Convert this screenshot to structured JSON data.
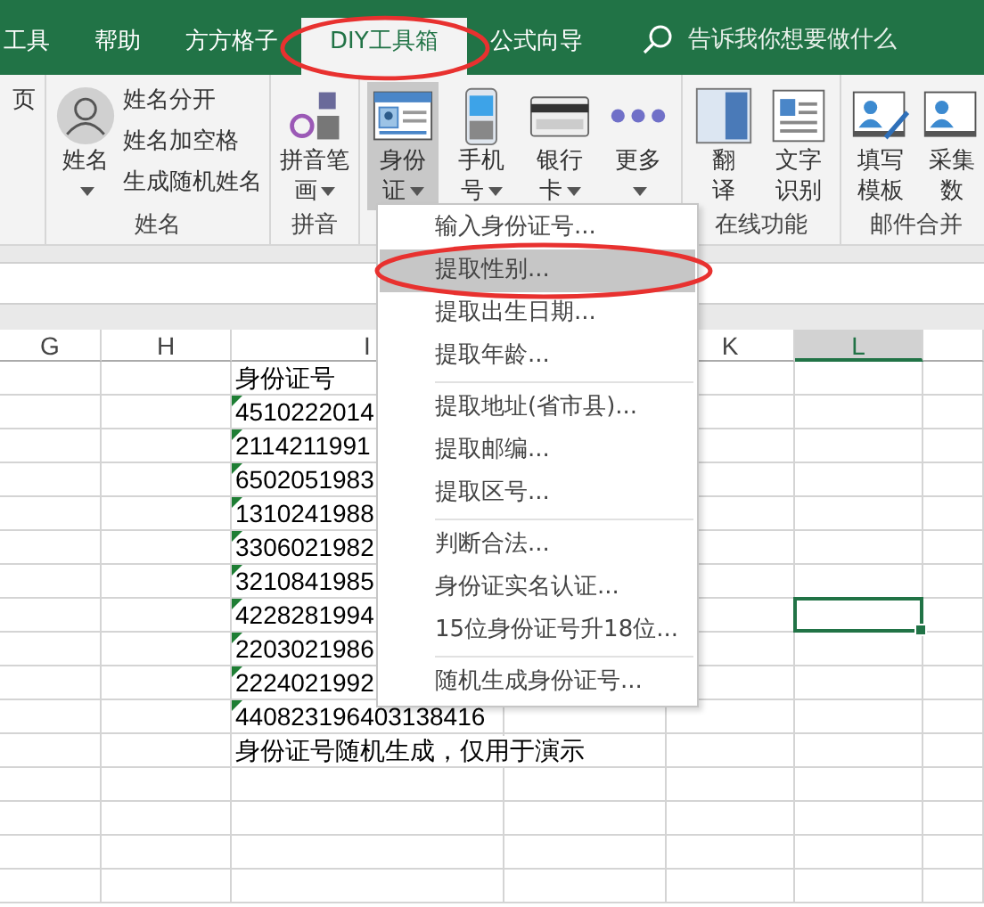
{
  "tabs": [
    {
      "label": "工具",
      "selected": false,
      "circled": false
    },
    {
      "label": "帮助",
      "selected": false,
      "circled": false
    },
    {
      "label": "方方格子",
      "selected": false,
      "circled": false
    },
    {
      "label": "DIY工具箱",
      "selected": true,
      "circled": true
    },
    {
      "label": "公式向导",
      "selected": false,
      "circled": false
    }
  ],
  "search": {
    "placeholder": "告诉我你想要做什么"
  },
  "ribbon": {
    "groups": [
      {
        "small": [
          "页"
        ]
      },
      {
        "label": "姓名",
        "buttons": [
          {
            "kind": "avatar",
            "label": "姓名",
            "dropdown": true,
            "pressed": false
          }
        ],
        "small": [
          "姓名分开",
          "姓名加空格",
          "生成随机姓名"
        ]
      },
      {
        "label": "拼音",
        "buttons": [
          {
            "kind": "pinyin",
            "label": "拼音笔画",
            "dropdown": true,
            "pressed": false
          }
        ]
      },
      {
        "buttons": [
          {
            "kind": "idcard",
            "label": "身份证",
            "dropdown": true,
            "pressed": true
          },
          {
            "kind": "phone",
            "label": "手机号",
            "dropdown": true,
            "pressed": false
          },
          {
            "kind": "bankcard",
            "label": "银行卡",
            "dropdown": true,
            "pressed": false
          },
          {
            "kind": "more",
            "label": "更多",
            "dropdown": true,
            "pressed": false
          }
        ]
      },
      {
        "label": "在线功能",
        "buttons": [
          {
            "kind": "translate",
            "label": "翻译",
            "dropdown": false,
            "pressed": false
          },
          {
            "kind": "ocr",
            "label": "文字识别",
            "dropdown": false,
            "pressed": false
          }
        ]
      },
      {
        "label": "邮件合并",
        "buttons": [
          {
            "kind": "template",
            "label": "填写模板",
            "dropdown": false,
            "pressed": false
          },
          {
            "kind": "collect",
            "label": "采集数",
            "dropdown": false,
            "pressed": false
          }
        ]
      }
    ]
  },
  "sheet": {
    "columns": [
      {
        "label": "G",
        "selected": false
      },
      {
        "label": "H",
        "selected": false
      },
      {
        "label": "I",
        "selected": false
      },
      {},
      {
        "label": "K",
        "selected": false
      },
      {
        "label": "L",
        "selected": true
      },
      {
        "selected": false
      }
    ],
    "rows": [
      {
        "column_i": "身份证号",
        "text_flag": false,
        "l_selected": false
      },
      {
        "column_i": "4510222014",
        "text_flag": true,
        "l_selected": false
      },
      {
        "column_i": "2114211991",
        "text_flag": true,
        "l_selected": false
      },
      {
        "column_i": "6502051983",
        "text_flag": true,
        "l_selected": false
      },
      {
        "column_i": "1310241988",
        "text_flag": true,
        "l_selected": false
      },
      {
        "column_i": "3306021982",
        "text_flag": true,
        "l_selected": false
      },
      {
        "column_i": "3210841985",
        "text_flag": true,
        "l_selected": false
      },
      {
        "column_i": "4228281994",
        "text_flag": true,
        "l_selected": true
      },
      {
        "column_i": "2203021986",
        "text_flag": true,
        "l_selected": false
      },
      {
        "column_i": "2224021992",
        "text_flag": true,
        "l_selected": false
      },
      {
        "column_i": "440823196403138416",
        "text_flag": true,
        "l_selected": false
      },
      {
        "column_i": "身份证号随机生成，仅用于演示",
        "text_flag": false,
        "l_selected": false
      },
      {
        "text_flag": false,
        "l_selected": false
      },
      {
        "text_flag": false,
        "l_selected": false
      },
      {
        "text_flag": false,
        "l_selected": false
      },
      {
        "text_flag": false,
        "l_selected": false
      }
    ]
  },
  "menu": {
    "items": [
      {
        "label": "输入身份证号...",
        "selected": false,
        "separator_before": false,
        "circled": false
      },
      {
        "label": "提取性别...",
        "selected": true,
        "separator_before": false,
        "circled": true
      },
      {
        "label": "提取出生日期...",
        "selected": false,
        "separator_before": false,
        "circled": false
      },
      {
        "label": "提取年龄...",
        "selected": false,
        "separator_before": false,
        "circled": false
      },
      {
        "label": "提取地址(省市县)...",
        "selected": false,
        "separator_before": true,
        "circled": false
      },
      {
        "label": "提取邮编...",
        "selected": false,
        "separator_before": false,
        "circled": false
      },
      {
        "label": "提取区号...",
        "selected": false,
        "separator_before": false,
        "circled": false
      },
      {
        "label": "判断合法...",
        "selected": false,
        "separator_before": true,
        "circled": false
      },
      {
        "label": "身份证实名认证...",
        "selected": false,
        "separator_before": false,
        "circled": false
      },
      {
        "label": "15位身份证号升18位...",
        "selected": false,
        "separator_before": false,
        "circled": false
      },
      {
        "label": "随机生成身份证号...",
        "selected": false,
        "separator_before": true,
        "circled": false
      }
    ]
  }
}
